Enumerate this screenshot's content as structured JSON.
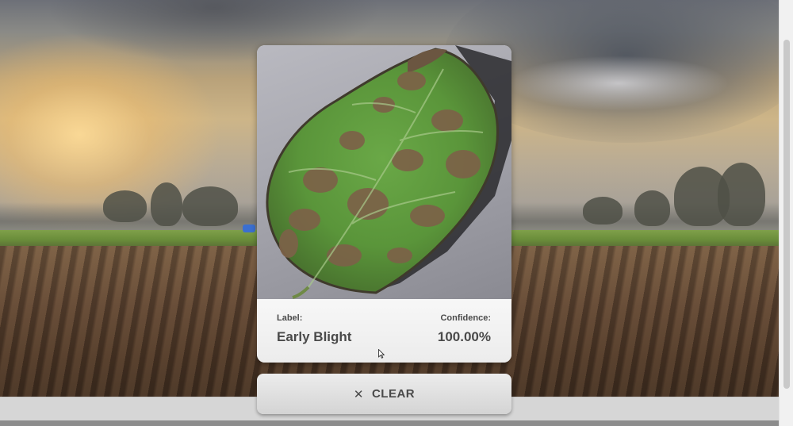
{
  "result": {
    "label_heading": "Label:",
    "label_value": "Early Blight",
    "confidence_heading": "Confidence:",
    "confidence_value": "100.00%"
  },
  "clear_button": {
    "icon": "close-icon",
    "label": "CLEAR"
  },
  "colors": {
    "card_text": "#4a4a4a",
    "leaf_green": "#5f9a3e",
    "lesion_brown": "#7c6248"
  }
}
